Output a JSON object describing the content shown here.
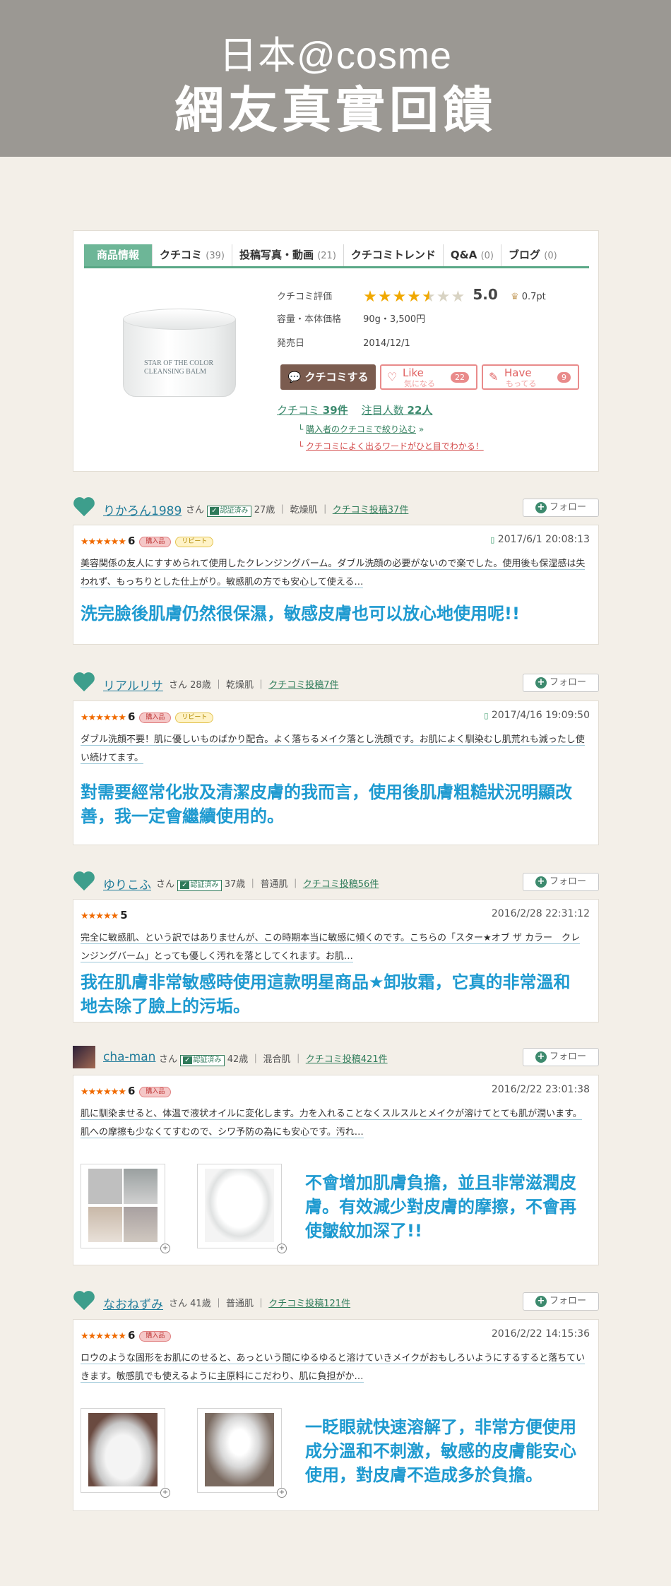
{
  "hero": {
    "line1": "日本@cosme",
    "line2": "網友真實回饋"
  },
  "product": {
    "tabs": [
      {
        "label": "商品情報",
        "count": ""
      },
      {
        "label": "クチコミ",
        "count": "(39)"
      },
      {
        "label": "投稿写真・動画",
        "count": "(21)"
      },
      {
        "label": "クチコミトレンド",
        "count": ""
      },
      {
        "label": "Q&A",
        "count": "(0)"
      },
      {
        "label": "ブログ",
        "count": "(0)"
      }
    ],
    "jar_label": "STAR OF THE COLOR\nCLEANSING BALM",
    "rating_key": "クチコミ評価",
    "rating_stars": 4.5,
    "rating_value": "5.0",
    "rating_pt": "0.7pt",
    "volume_key": "容量・本体価格",
    "volume_value": "90g・3,500円",
    "release_key": "発売日",
    "release_value": "2014/12/1",
    "btn_kuchi": "クチコミする",
    "like": {
      "t1": "Like",
      "t2": "気になる",
      "count": "22"
    },
    "have": {
      "t1": "Have",
      "t2": "もってる",
      "count": "9"
    },
    "kuchi_label": "クチコミ",
    "kuchi_count": "39件",
    "chumoku_label": "注目人数",
    "chumoku_count": "22人",
    "sub1": "購入者のクチコミで絞り込む",
    "sub2": "クチコミによく出るワードがひと目でわかる！"
  },
  "follow_label": "フォロー",
  "verified_label": "認証済み",
  "tags": {
    "buy": "購入品",
    "repeat": "リピート"
  },
  "reviews": [
    {
      "name": "りかろん1989",
      "san": "さん",
      "age": "27歳",
      "skin": "乾燥肌",
      "posts": "クチコミ投稿37件",
      "stars": 6,
      "score": "6",
      "date": "2017/6/1 20:08:13",
      "text": "美容関係の友人にすすめられて使用したクレンジングバーム。ダブル洗顔の必要がないので楽でした。使用後も保湿感は失われず、もっちりとした仕上がり。敏感肌の方でも安心して使える…",
      "zh": "洗完臉後肌膚仍然很保濕，敏感皮膚也可以放心地使用呢!!"
    },
    {
      "name": "リアルリサ",
      "san": "さん",
      "age": "28歳",
      "skin": "乾燥肌",
      "posts": "クチコミ投稿7件",
      "stars": 6,
      "score": "6",
      "date": "2017/4/16 19:09:50",
      "text": "ダブル洗顔不要！肌に優しいものばかり配合。よく落ちるメイク落とし洗顔です。お肌によく馴染むし肌荒れも減ったし使い続けてます。",
      "zh": "對需要經常化妝及清潔皮膚的我而言，使用後肌膚粗糙狀況明顯改善，我一定會繼續使用的。"
    },
    {
      "name": "ゆりこふ",
      "san": "さん",
      "age": "37歳",
      "skin": "普通肌",
      "posts": "クチコミ投稿56件",
      "stars": 5,
      "score": "5",
      "date": "2016/2/28 22:31:12",
      "text": "完全に敏感肌、という訳ではありませんが、この時期本当に敏感に傾くのです。こちらの「スター★オブ ザ カラー　クレンジングバーム」とっても優しく汚れを落としてくれます。お肌…",
      "zh": "我在肌膚非常敏感時使用這款明星商品★卸妝霜，它真的非常溫和地去除了臉上的污垢。"
    },
    {
      "name": "cha-man",
      "san": "さん",
      "age": "42歳",
      "skin": "混合肌",
      "posts": "クチコミ投稿421件",
      "stars": 6,
      "score": "6",
      "date": "2016/2/22 23:01:38",
      "text": "肌に馴染ませると、体温で液状オイルに変化します。力を入れることなくスルスルとメイクが溶けてとても肌が潤います。肌への摩擦も少なくてすむので、シワ予防の為にも安心です。汚れ…",
      "zh": "不會增加肌膚負擔，並且非常滋潤皮膚。有效減少對皮膚的摩擦，不會再使皺紋加深了!!"
    },
    {
      "name": "なおねずみ",
      "san": "さん",
      "age": "41歳",
      "skin": "普通肌",
      "posts": "クチコミ投稿121件",
      "stars": 6,
      "score": "6",
      "date": "2016/2/22 14:15:36",
      "text": "ロウのような固形をお肌にのせると、あっという間にゆるゆると溶けていきメイクがおもしろいようにするすると落ちていきます。敏感肌でも使えるように主原料にこだわり、肌に負担がか…",
      "zh": "一眨眼就快速溶解了，非常方便使用成分溫和不刺激，敏感的皮膚能安心使用，對皮膚不造成多於負擔。"
    }
  ],
  "colors": {
    "hero_bg": "#9b9893",
    "page_bg": "#f3efe8",
    "accent_green": "#6db697",
    "zh_blue": "#1e9ad0"
  }
}
